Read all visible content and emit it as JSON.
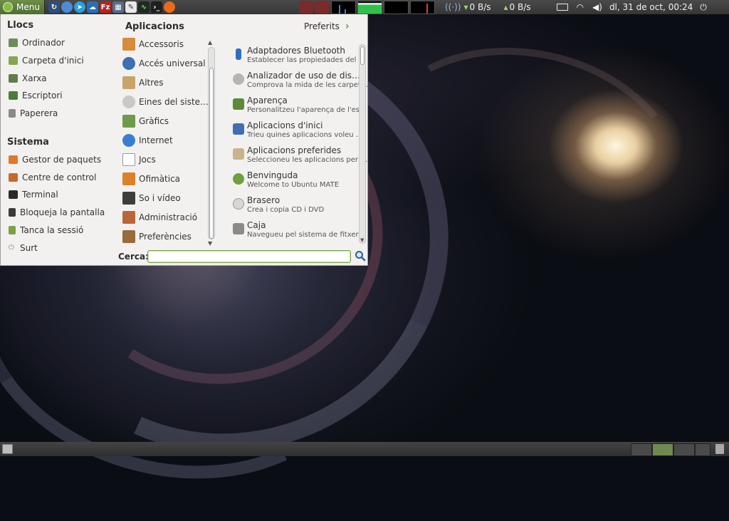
{
  "top_panel": {
    "menu_label": "Menu",
    "net_down": "0 B/s",
    "net_up": "0 B/s",
    "clock": "dl, 31 de oct, 00:24"
  },
  "menu": {
    "places_title": "Llocs",
    "places": [
      "Ordinador",
      "Carpeta d'inici",
      "Xarxa",
      "Escriptori",
      "Paperera"
    ],
    "system_title": "Sistema",
    "system": [
      "Gestor de paquets",
      "Centre de control",
      "Terminal",
      "Bloqueja la pantalla",
      "Tanca la sessió",
      "Surt"
    ],
    "apps_title": "Aplicacions",
    "favorites_label": "Preferits",
    "categories": [
      "Accessoris",
      "Accés universal",
      "Altres",
      "Eines del siste…",
      "Gràfics",
      "Internet",
      "Jocs",
      "Ofimàtica",
      "So i vídeo",
      "Administració",
      "Preferències"
    ],
    "apps": [
      {
        "name": "Adaptadores Bluetooth",
        "desc": "Establecer las propiedades del …"
      },
      {
        "name": "Analizador de uso de dis…",
        "desc": "Comprova la mida de les carpet…"
      },
      {
        "name": "Aparença",
        "desc": "Personalitzeu l'aparença de l'es…"
      },
      {
        "name": "Aplicacions d'inici",
        "desc": "Trieu quines aplicacions voleu …"
      },
      {
        "name": "Aplicacions preferides",
        "desc": "Seleccioneu les aplicacions per …"
      },
      {
        "name": "Benvinguda",
        "desc": "Welcome to Ubuntu MATE"
      },
      {
        "name": "Brasero",
        "desc": "Crea i copia CD i DVD"
      },
      {
        "name": "Caja",
        "desc": "Navegueu pel sistema de fitxer…"
      }
    ],
    "search_label": "Cerca:",
    "search_value": ""
  },
  "icons": {
    "menu_logo": "ubuntu-mate-icon",
    "launchers": [
      "refresh-icon",
      "chromium-icon",
      "telegram-icon",
      "cloud-icon",
      "filezilla-icon",
      "calculator-icon",
      "text-editor-icon",
      "system-monitor-icon",
      "terminal-icon",
      "firefox-icon"
    ],
    "tray": [
      "network-indicator-icon",
      "battery-icon",
      "wifi-icon",
      "volume-icon",
      "power-icon"
    ],
    "search": "search-icon"
  },
  "colors": {
    "accent": "#87a556",
    "menu_bg": "#f2f1f0",
    "panel_bg": "#3c3c3c"
  }
}
